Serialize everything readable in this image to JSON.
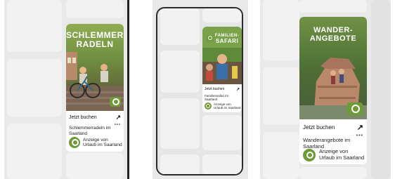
{
  "panel1": {
    "card": {
      "hero_title_line1": "SCHLEMMER-",
      "hero_title_line2": "RADELN",
      "book_label": "Jetzt buchen",
      "arrow": "↗",
      "ad_title_line1": "Schlemmerradeln im",
      "ad_title_line2": "Saarland",
      "dots": "•••",
      "sponsor_line1": "Anzeige von",
      "sponsor_line2": "Urlaub im Saarland"
    }
  },
  "panel2": {
    "card": {
      "hero_title_line1": "FAMILIEN-",
      "hero_title_line2": "SAFARI",
      "book_label": "Jetzt buchen",
      "arrow": "↗",
      "ad_title_line1": "Familiensafari im",
      "ad_title_line2": "Saarland",
      "sponsor_line1": "Anzeige von",
      "sponsor_line2": "Urlaub im Saarland"
    }
  },
  "panel3": {
    "card": {
      "hero_title_line1": "WANDER-",
      "hero_title_line2": "ANGEBOTE",
      "book_label": "Jetzt buchen",
      "arrow": "↗",
      "ad_title_line1": "Wanderangebote im",
      "ad_title_line2": "Saarland",
      "dots": "•••",
      "sponsor_line1": "Anzeige von",
      "sponsor_line2": "Urlaub im Saarland"
    }
  },
  "colors": {
    "brand_green": "#6f9a38",
    "tile_gray": "#f2f2f2",
    "panel_bg": "#e9e9e9",
    "divider": "#222222"
  }
}
